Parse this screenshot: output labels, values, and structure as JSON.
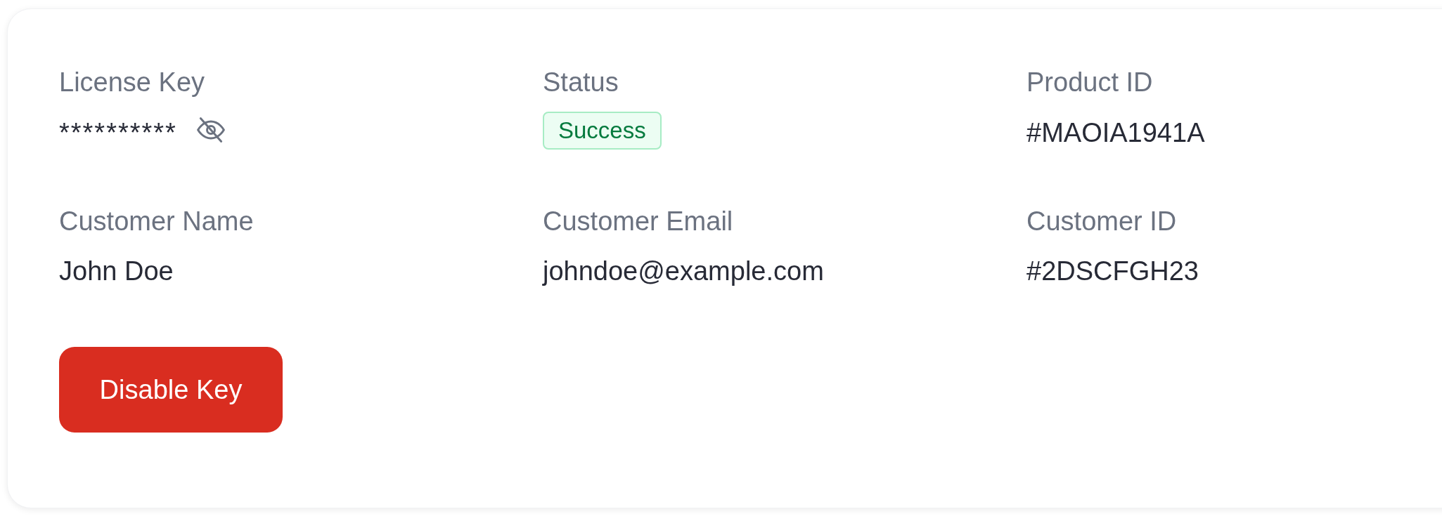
{
  "fields": [
    {
      "label": "License Key",
      "kind": "secret",
      "value": "**********"
    },
    {
      "label": "Status",
      "kind": "badge",
      "value": "Success"
    },
    {
      "label": "Product ID",
      "kind": "text",
      "value": "#MAOIA1941A"
    },
    {
      "label": "Customer Name",
      "kind": "text",
      "value": "John Doe"
    },
    {
      "label": "Customer Email",
      "kind": "text",
      "value": "johndoe@example.com"
    },
    {
      "label": "Customer ID",
      "kind": "text",
      "value": "#2DSCFGH23"
    }
  ],
  "button": {
    "label": "Disable Key"
  }
}
